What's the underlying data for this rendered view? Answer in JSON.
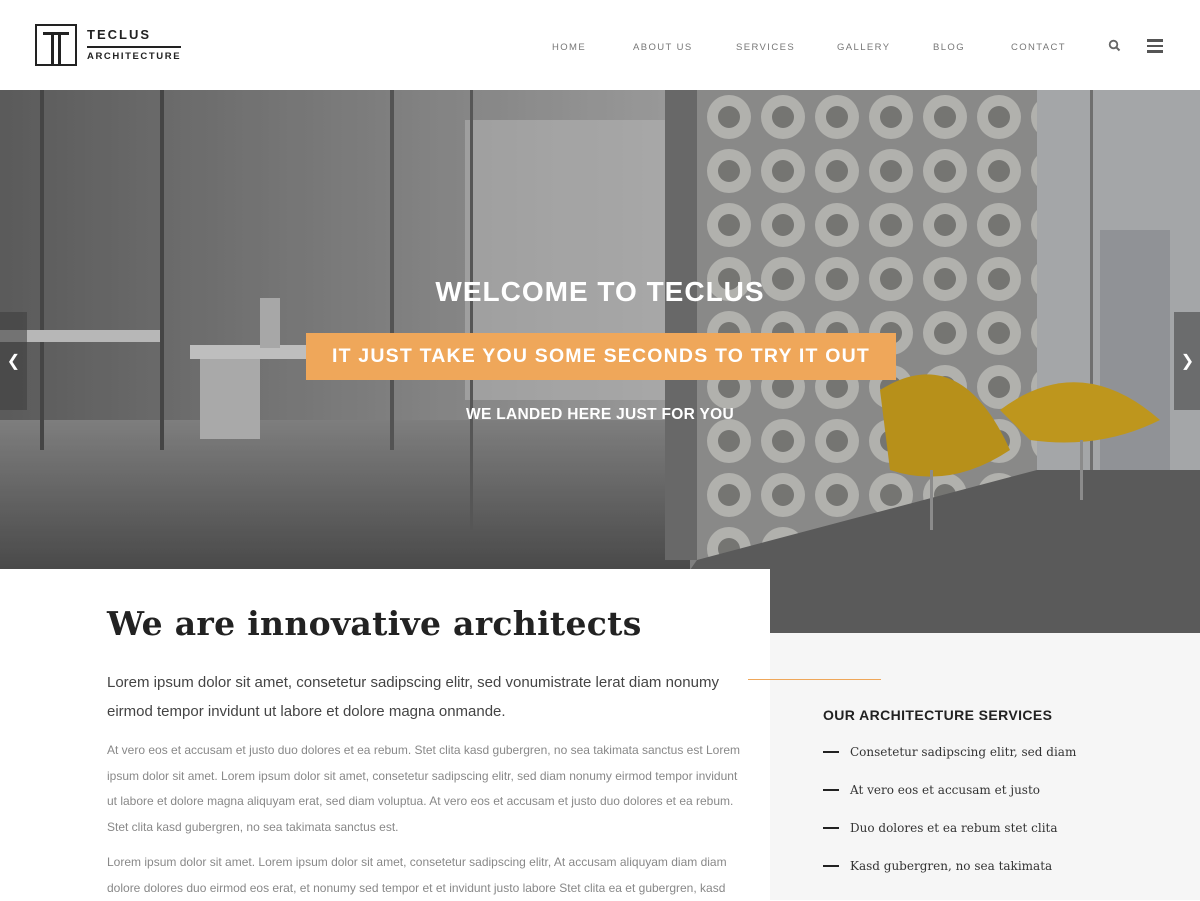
{
  "brand": {
    "name": "TECLUS",
    "tagline": "ARCHITECTURE"
  },
  "nav": {
    "items": [
      "HOME",
      "ABOUT US",
      "SERVICES",
      "GALLERY",
      "BLOG",
      "CONTACT"
    ],
    "icons": [
      "search-icon",
      "hamburger-menu-icon"
    ]
  },
  "hero": {
    "title": "WELCOME TO TECLUS",
    "cta": "IT JUST TAKE YOU SOME SECONDS TO TRY IT OUT",
    "subtitle": "WE LANDED HERE JUST FOR YOU",
    "prev_icon": "chevron-left-icon",
    "next_icon": "chevron-right-icon"
  },
  "about": {
    "heading": "We are innovative architects",
    "lead": "Lorem ipsum dolor sit amet, consetetur sadipscing elitr, sed vonumistrate lerat diam nonumy eirmod tempor invidunt ut labore et dolore magna onmande.",
    "paragraph1": "At vero eos et accusam et justo duo dolores et ea rebum. Stet clita kasd gubergren, no sea takimata sanctus est Lorem ipsum dolor sit amet. Lorem ipsum dolor sit amet, consetetur sadipscing elitr, sed diam nonumy eirmod tempor invidunt ut labore et dolore magna aliquyam erat, sed diam voluptua. At vero eos et accusam et justo duo dolores et ea rebum. Stet clita kasd gubergren, no sea takimata sanctus est.",
    "paragraph2": "Lorem ipsum dolor sit amet. Lorem ipsum dolor sit amet, consetetur sadipscing elitr, At accusam aliquyam diam diam dolore dolores duo eirmod eos erat, et nonumy sed tempor et et invidunt justo labore Stet clita ea et gubergren, kasd"
  },
  "services": {
    "title": "OUR ARCHITECTURE SERVICES",
    "items": [
      "Consetetur sadipscing elitr, sed diam",
      "At vero eos et accusam et justo",
      "Duo dolores et ea rebum stet clita",
      "Kasd gubergren, no sea takimata"
    ]
  },
  "colors": {
    "accent": "#efa75a",
    "text_dark": "#222222",
    "text_muted": "#888888",
    "panel_bg": "#f6f6f6"
  }
}
